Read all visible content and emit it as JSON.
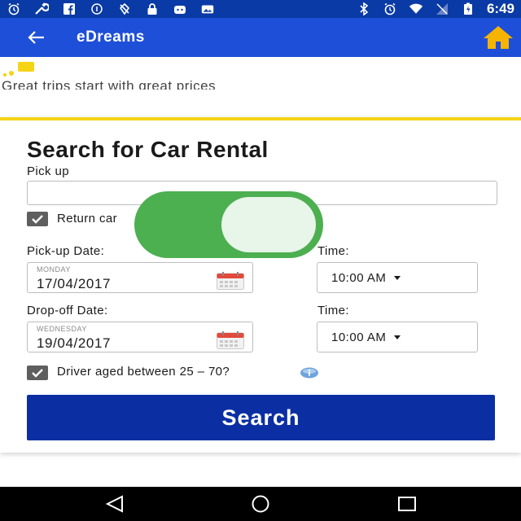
{
  "status_bar": {
    "time": "6:49",
    "icons_left": [
      "alarm-icon",
      "wrench-icon",
      "facebook-icon",
      "data-saver-icon",
      "no-location-icon",
      "lock-icon",
      "android-icon",
      "photo-icon"
    ],
    "icons_right": [
      "bluetooth-icon",
      "alarm-icon",
      "wifi-icon",
      "no-signal-icon",
      "battery-icon"
    ]
  },
  "app_bar": {
    "title": "eDreams",
    "home_icon_color": "#f6b400"
  },
  "tagline": "Great trips start with great prices",
  "form": {
    "title": "Search for Car Rental",
    "pickup_label": "Pick up",
    "pickup_value": "",
    "return_checkbox_label": "Return car",
    "return_checked": true,
    "pickup_date_label": "Pick-up Date:",
    "pickup_day": "MONDAY",
    "pickup_date": "17/04/2017",
    "pickup_time_label": "Time:",
    "pickup_time": "10:00 AM",
    "dropoff_date_label": "Drop-off Date:",
    "dropoff_day": "WEDNESDAY",
    "dropoff_date": "19/04/2017",
    "dropoff_time_label": "Time:",
    "dropoff_time": "10:00 AM",
    "driver_checkbox_label": "Driver aged between 25 – 70?",
    "driver_checked": true,
    "search_label": "Search"
  },
  "toggle": {
    "on": true,
    "color": "#4caf50"
  },
  "colors": {
    "status_bar": "#0a3aa5",
    "app_bar": "#1e4fd8",
    "accent_yellow": "#f5d416",
    "search_button": "#0b2fa3"
  }
}
